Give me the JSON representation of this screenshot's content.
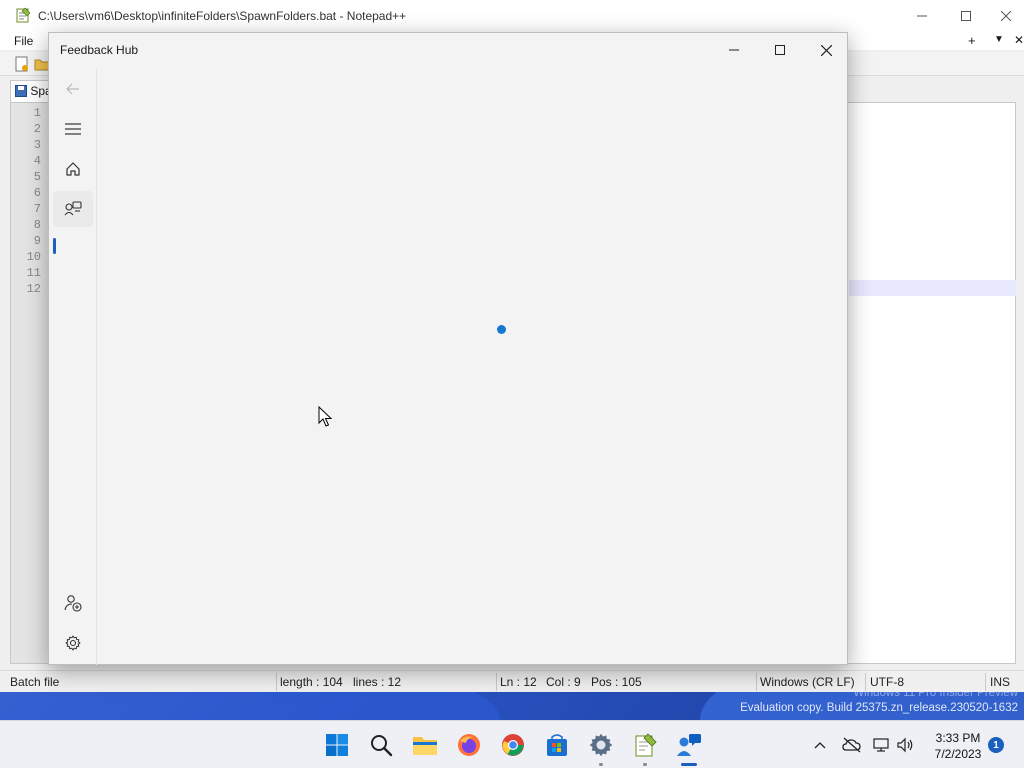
{
  "notepad": {
    "title": "C:\\Users\\vm6\\Desktop\\infiniteFolders\\SpawnFolders.bat - Notepad++",
    "menu_file": "File",
    "tab_label": "Spa",
    "line_numbers": [
      "1",
      "2",
      "3",
      "4",
      "5",
      "6",
      "7",
      "8",
      "9",
      "10",
      "11",
      "12"
    ],
    "status": {
      "file_type": "Batch file",
      "length": "length : 104",
      "lines": "lines : 12",
      "ln": "Ln : 12",
      "col": "Col : 9",
      "pos": "Pos : 105",
      "eol": "Windows (CR LF)",
      "encoding": "UTF-8",
      "mode": "INS"
    },
    "menubar_plus": "+",
    "menubar_down": "▼",
    "menubar_close": "✕"
  },
  "feedback_hub": {
    "title": "Feedback Hub",
    "nav": {
      "back": "back-arrow-icon",
      "menu": "hamburger-icon",
      "home": "home-icon",
      "feedback": "feedback-icon",
      "add_account": "add-account-icon",
      "settings": "gear-icon"
    },
    "accent": "#1677d2"
  },
  "desktop": {
    "watermark_line1": "Windows 11 Pro Insider Preview",
    "watermark_line2": "Evaluation copy. Build 25375.zn_release.230520-1632"
  },
  "taskbar": {
    "apps": [
      "start",
      "search",
      "file-explorer",
      "firefox",
      "chrome",
      "microsoft-store",
      "settings",
      "notepad-plus-plus",
      "feedback-hub"
    ],
    "time": "3:33 PM",
    "date": "7/2/2023",
    "notification_count": "1",
    "accent": "#1b5fbf"
  }
}
